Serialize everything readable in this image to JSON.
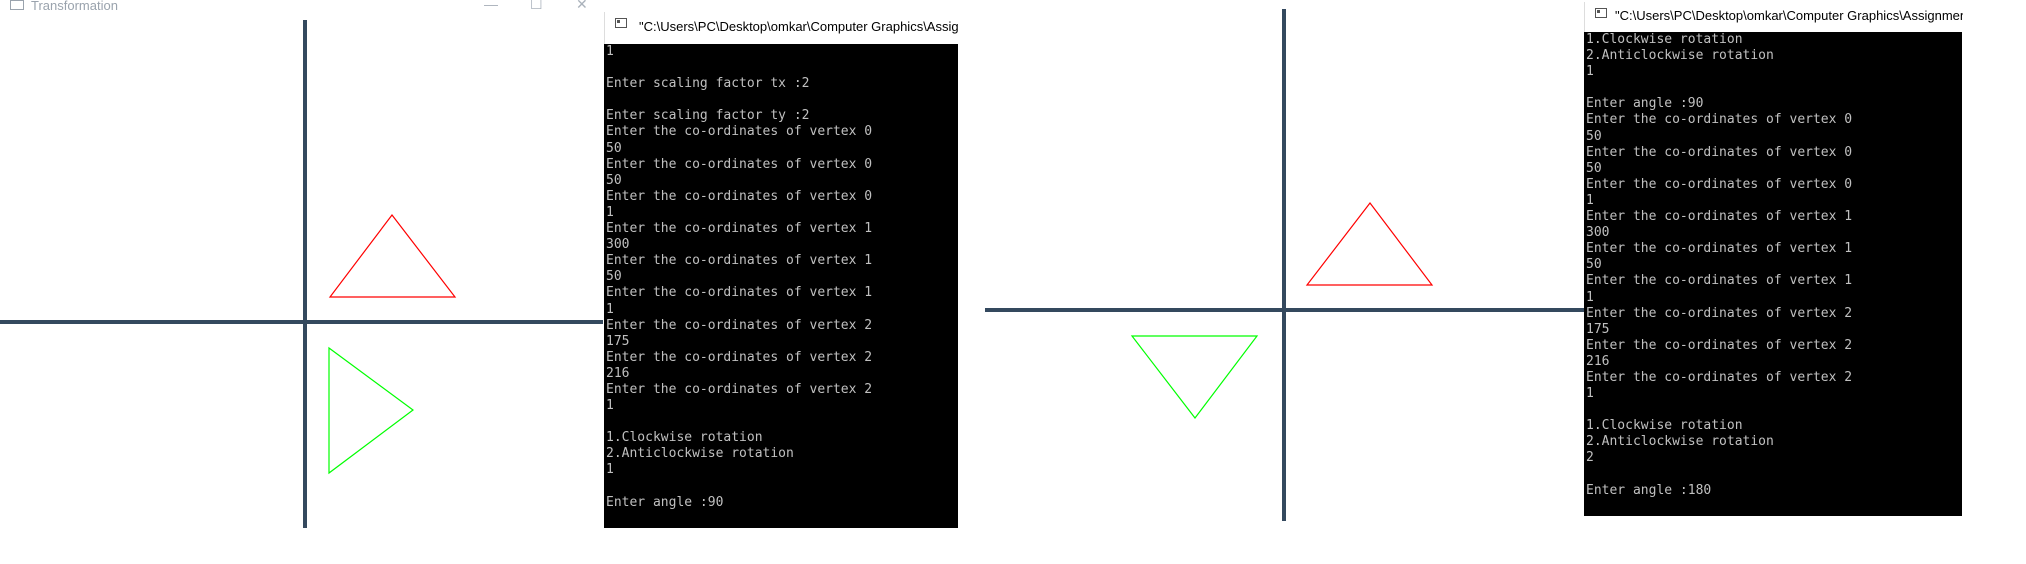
{
  "graphics_window_1": {
    "title": "Transformation",
    "controls": {
      "minimize": "—",
      "maximize": "☐",
      "close": "✕"
    },
    "axis_color": "#34495e",
    "red_triangle_color": "#ff0000",
    "green_triangle_color": "#00ff00"
  },
  "console_1": {
    "title": "\"C:\\Users\\PC\\Desktop\\omkar\\Computer Graphics\\Assignme",
    "lines": [
      "1",
      "",
      "Enter scaling factor tx :2",
      "",
      "Enter scaling factor ty :2",
      "Enter the co-ordinates of vertex 0",
      "50",
      "Enter the co-ordinates of vertex 0",
      "50",
      "Enter the co-ordinates of vertex 0",
      "1",
      "Enter the co-ordinates of vertex 1",
      "300",
      "Enter the co-ordinates of vertex 1",
      "50",
      "Enter the co-ordinates of vertex 1",
      "1",
      "Enter the co-ordinates of vertex 2",
      "175",
      "Enter the co-ordinates of vertex 2",
      "216",
      "Enter the co-ordinates of vertex 2",
      "1",
      "",
      "1.Clockwise rotation",
      "2.Anticlockwise rotation",
      "1",
      "",
      "Enter angle :90"
    ]
  },
  "graphics_window_2": {
    "axis_color": "#34495e",
    "red_triangle_color": "#ff0000",
    "green_triangle_color": "#00ff00"
  },
  "console_2": {
    "title": "\"C:\\Users\\PC\\Desktop\\omkar\\Computer Graphics\\Assignments\\",
    "lines": [
      "1.Clockwise rotation",
      "2.Anticlockwise rotation",
      "1",
      "",
      "Enter angle :90",
      "Enter the co-ordinates of vertex 0",
      "50",
      "Enter the co-ordinates of vertex 0",
      "50",
      "Enter the co-ordinates of vertex 0",
      "1",
      "Enter the co-ordinates of vertex 1",
      "300",
      "Enter the co-ordinates of vertex 1",
      "50",
      "Enter the co-ordinates of vertex 1",
      "1",
      "Enter the co-ordinates of vertex 2",
      "175",
      "Enter the co-ordinates of vertex 2",
      "216",
      "Enter the co-ordinates of vertex 2",
      "1",
      "",
      "1.Clockwise rotation",
      "2.Anticlockwise rotation",
      "2",
      "",
      "Enter angle :180"
    ]
  }
}
